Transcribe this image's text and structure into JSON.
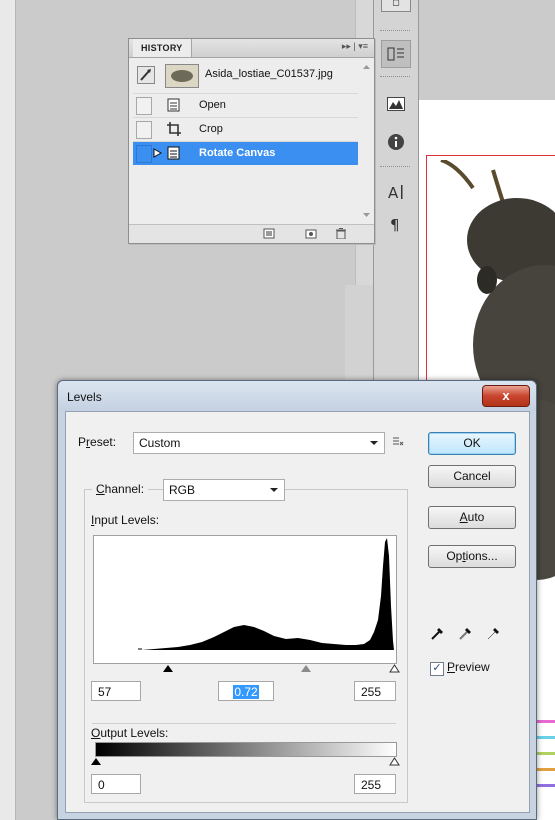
{
  "history_panel": {
    "tab_label": "HISTORY",
    "snapshot_label": "Asida_lostiae_C01537.jpg",
    "states": [
      {
        "label": "Open",
        "selected": false
      },
      {
        "label": "Crop",
        "selected": false
      },
      {
        "label": "Rotate Canvas",
        "selected": true
      }
    ]
  },
  "dock_icons": [
    "history-icon",
    "histogram-icon",
    "info-icon",
    "character-icon",
    "paragraph-icon"
  ],
  "levels_dialog": {
    "title": "Levels",
    "close_label": "x",
    "preset_label_pre": "P",
    "preset_label_mn": "r",
    "preset_label_post": "eset:",
    "preset_value": "Custom",
    "channel_label_mn": "C",
    "channel_label_post": "hannel:",
    "channel_value": "RGB",
    "input_levels_mn": "I",
    "input_levels_post": "nput Levels:",
    "input_black": "57",
    "input_gamma": "0.72",
    "input_white": "255",
    "output_levels_mn": "O",
    "output_levels_post": "utput Levels:",
    "output_black": "0",
    "output_white": "255",
    "buttons": {
      "ok": "OK",
      "cancel": "Cancel",
      "auto_mn": "A",
      "auto_post": "uto",
      "options_pre": "Op",
      "options_mn": "t",
      "options_post": "ions..."
    },
    "preview_mn": "P",
    "preview_post": "review",
    "preview_checked": "✓",
    "accent_color": "#3399ff"
  }
}
